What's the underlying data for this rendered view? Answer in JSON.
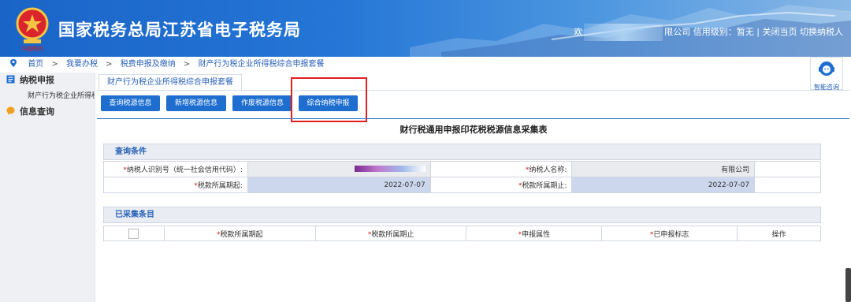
{
  "header": {
    "title": "国家税务总局江苏省电子税务局",
    "welcome_prefix": "欢",
    "company_suffix": "限公司",
    "credit_rating": "信用级别：暂无",
    "divider": "|",
    "close_page": "关闭当页",
    "switch_taxpayer": "切换纳税人"
  },
  "breadcrumb": {
    "items": [
      "首页",
      "我要办税",
      "税费申报及缴纳",
      "财产行为税企业所得税综合申报套餐"
    ],
    "separator": ">"
  },
  "sidebar": {
    "items": [
      {
        "label": "纳税申报",
        "sub": [
          "财产行为税企业所得税"
        ]
      },
      {
        "label": "信息查询",
        "sub": []
      }
    ]
  },
  "consult": {
    "label": "智能咨询"
  },
  "tabs": [
    {
      "label": "财产行为税企业所得税综合申报套餐"
    }
  ],
  "toolbar": {
    "buttons": [
      "查询税源信息",
      "新增税源信息",
      "作废税源信息",
      "综合纳税申报"
    ]
  },
  "form": {
    "title": "财行税通用申报印花税税源信息采集表",
    "query_section": "查询条件",
    "taxpayer_id_label": "纳税人识别号（统一社会信用代码）:",
    "taxpayer_name_label": "纳税人名称:",
    "taxpayer_name_value": "有限公司",
    "period_start_label": "税款所属期起:",
    "period_start_value": "2022-07-07",
    "period_end_label": "税款所属期止:",
    "period_end_value": "2022-07-07",
    "required_mark": "*",
    "collected_section": "已采集条目",
    "columns": [
      "税款所属期起",
      "税款所属期止",
      "申报属性",
      "已申报标志",
      "操作"
    ]
  },
  "colors": {
    "header_blue": "#1e6ed0",
    "highlight_red": "#e02020",
    "required_red": "#d62020"
  }
}
